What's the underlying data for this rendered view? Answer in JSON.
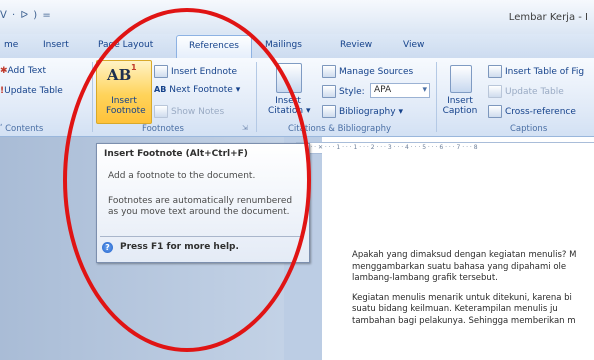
{
  "window": {
    "qat": "ᐯ · ᐅ ) =",
    "title": "Lembar Kerja - I"
  },
  "tabs": [
    {
      "label": "me"
    },
    {
      "label": "Insert"
    },
    {
      "label": "Page Layout"
    },
    {
      "label": "References"
    },
    {
      "label": "Mailings"
    },
    {
      "label": "Review"
    },
    {
      "label": "View"
    }
  ],
  "toc_group": {
    "add_text": "Add Text",
    "update_table": "Update Table",
    "label": "Contents"
  },
  "footnotes_group": {
    "insert_footnote": [
      "Insert",
      "Footnote"
    ],
    "insert_endnote": "Insert Endnote",
    "next_footnote": "Next Footnote",
    "show_notes": "Show Notes",
    "label": "Footnotes",
    "ab_glyph": "AB",
    "ab_sup": "1"
  },
  "citations_group": {
    "insert_citation": [
      "Insert",
      "Citation"
    ],
    "manage_sources": "Manage Sources",
    "style_label": "Style:",
    "style_value": "APA",
    "bibliography": "Bibliography",
    "label": "Citations & Bibliography"
  },
  "captions_group": {
    "insert_caption": [
      "Insert",
      "Caption"
    ],
    "insert_table_of_figures": "Insert Table of Fig",
    "update_table": "Update Table",
    "cross_reference": "Cross-reference",
    "label": "Captions"
  },
  "tooltip": {
    "title": "Insert Footnote (Alt+Ctrl+F)",
    "description": "Add a footnote to the document.",
    "note": "Footnotes are automatically renumbered as you move text around the document.",
    "help": "Press F1 for more help.",
    "help_icon": "?"
  },
  "ruler": {
    "text": "· 1 · · · ✕ · · · 1 · · · 1 · · · 2 · · · 3 · · · 4 · · · 5 · · · 6 · · · 7 · · · 8"
  },
  "document": {
    "paragraphs": [
      "Apakah yang dimaksud dengan kegiatan menulis? M menggambarkan suatu bahasa yang dipahami ole lambang-lambang grafik tersebut.",
      "Kegiatan menulis menarik untuk ditekuni, karena bi suatu bidang keilmuan. Keterampilan menulis ju tambahan bagi pelakunya. Sehingga memberikan m"
    ]
  },
  "colors": {
    "annotation": "#e01414",
    "highlight": "#ffd35a",
    "ribbon": "#dfe9f7"
  }
}
